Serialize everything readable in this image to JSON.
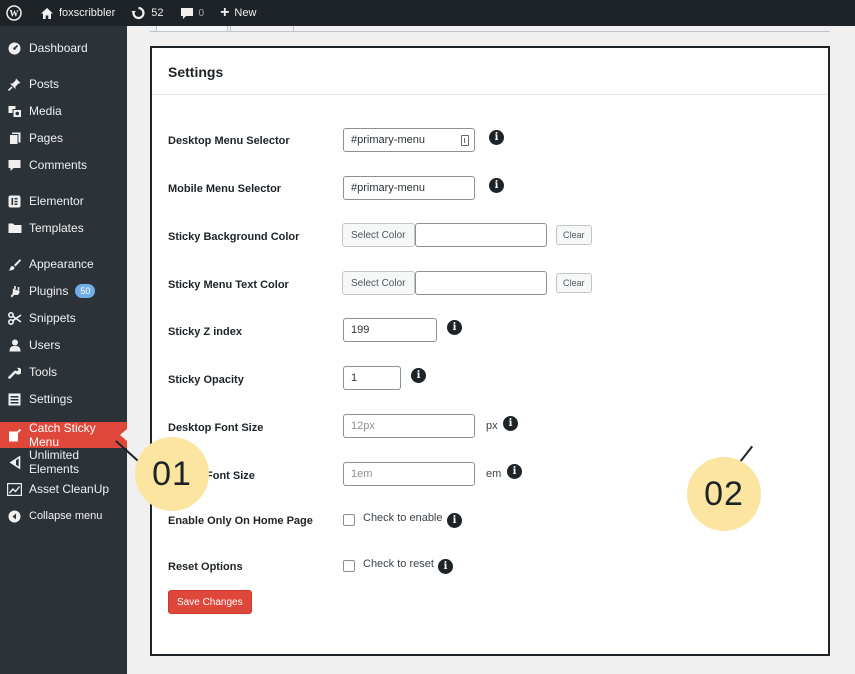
{
  "adminbar": {
    "site_name": "foxscribbler",
    "updates_count": "52",
    "comments_count": "0",
    "new_label": "New"
  },
  "sidebar": {
    "items": [
      {
        "label": "Dashboard",
        "icon": "dashboard-icon"
      },
      {
        "label": "Posts",
        "icon": "pin-icon"
      },
      {
        "label": "Media",
        "icon": "media-icon"
      },
      {
        "label": "Pages",
        "icon": "pages-icon"
      },
      {
        "label": "Comments",
        "icon": "comment-icon"
      },
      {
        "label": "Elementor",
        "icon": "elementor-icon"
      },
      {
        "label": "Templates",
        "icon": "folder-icon"
      },
      {
        "label": "Appearance",
        "icon": "brush-icon"
      },
      {
        "label": "Plugins",
        "icon": "plug-icon",
        "badge": "50"
      },
      {
        "label": "Snippets",
        "icon": "scissors-icon"
      },
      {
        "label": "Users",
        "icon": "user-icon"
      },
      {
        "label": "Tools",
        "icon": "wrench-icon"
      },
      {
        "label": "Settings",
        "icon": "settings-icon"
      },
      {
        "label": "Catch Sticky Menu",
        "icon": "sticky-menu-icon",
        "active": true
      },
      {
        "label": "Unlimited Elements",
        "icon": "unlimited-icon"
      },
      {
        "label": "Asset CleanUp",
        "icon": "cleanup-icon"
      },
      {
        "label": "Collapse menu",
        "icon": "collapse-icon"
      }
    ]
  },
  "panel": {
    "title": "Settings",
    "rows": {
      "desktop_menu_selector": {
        "label": "Desktop Menu Selector",
        "value": "#primary-menu"
      },
      "mobile_menu_selector": {
        "label": "Mobile Menu Selector",
        "value": "#primary-menu"
      },
      "sticky_bg_color": {
        "label": "Sticky Background Color",
        "select_label": "Select Color",
        "clear_label": "Clear"
      },
      "sticky_text_color": {
        "label": "Sticky Menu Text Color",
        "select_label": "Select Color",
        "clear_label": "Clear"
      },
      "sticky_z_index": {
        "label": "Sticky Z index",
        "value": "199"
      },
      "sticky_opacity": {
        "label": "Sticky Opacity",
        "value": "1"
      },
      "desktop_font_size": {
        "label": "Desktop Font Size",
        "placeholder": "12px",
        "unit": "px"
      },
      "mobile_font_size": {
        "label": "Font Size",
        "placeholder": "1em",
        "unit": "em"
      },
      "home_only": {
        "label": "Enable Only On Home Page",
        "check_label": "Check to enable"
      },
      "reset": {
        "label": "Reset Options",
        "check_label": "Check to reset"
      }
    },
    "save_label": "Save Changes"
  },
  "callouts": {
    "first": "01",
    "second": "02"
  },
  "colors": {
    "sidebar_bg": "#2c3338",
    "adminbar_bg": "#1d2327",
    "active_accent": "#e0473b",
    "callout_bg": "#fbe5a0",
    "badge_bg": "#72aee6"
  }
}
